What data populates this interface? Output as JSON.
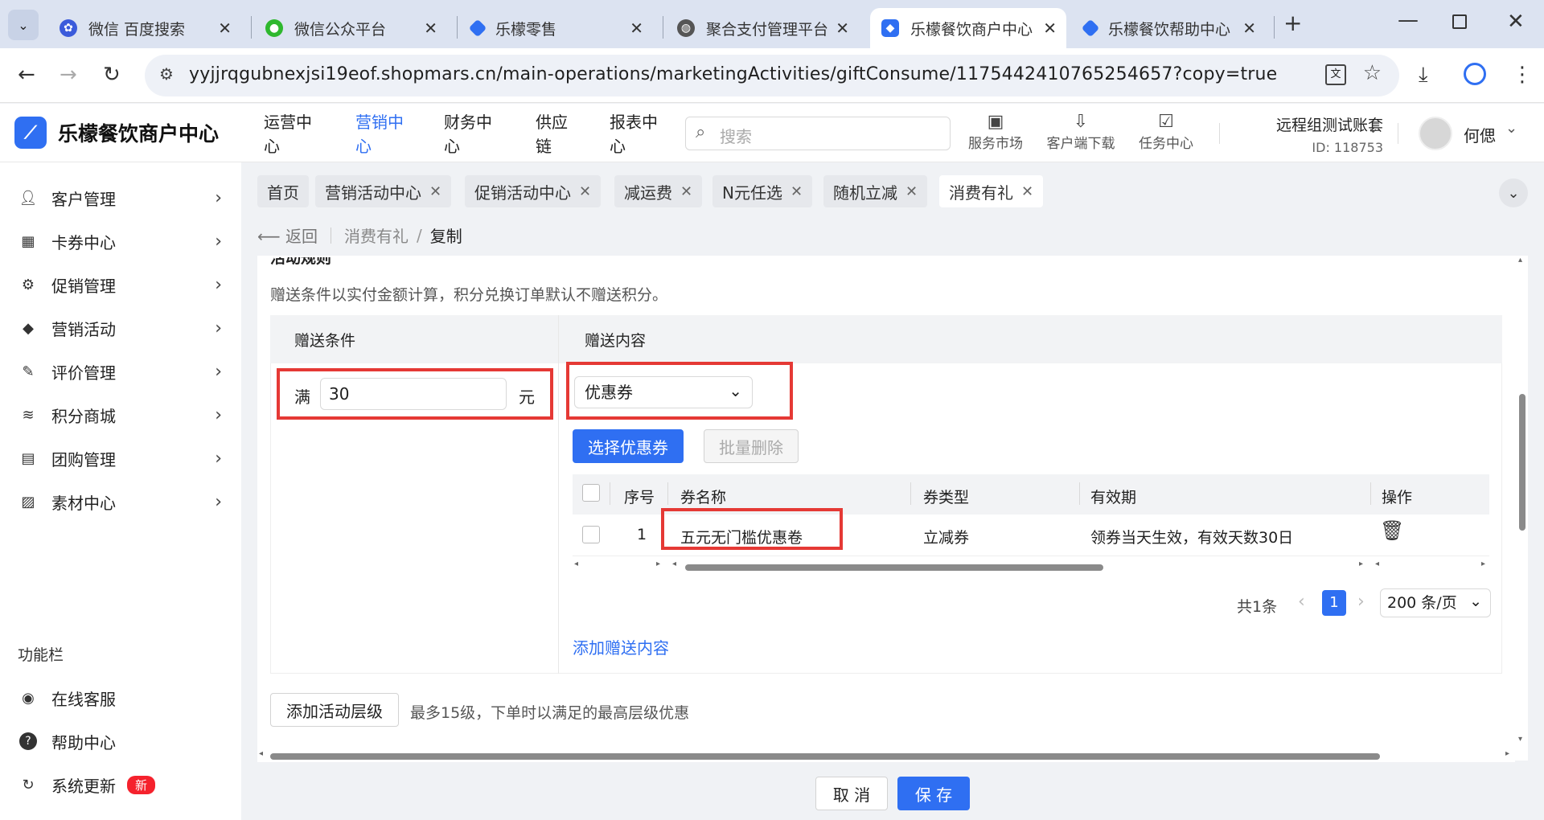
{
  "browser": {
    "tabs": [
      {
        "title": "微信 百度搜索",
        "icon": "baidu-icon",
        "color": "#3b5bdb"
      },
      {
        "title": "微信公众平台",
        "icon": "wechat-icon",
        "color": "#2eb82e"
      },
      {
        "title": "乐檬零售",
        "icon": "lemeng-icon",
        "color": "#2f6ff2"
      },
      {
        "title": "聚合支付管理平台",
        "icon": "globe-icon",
        "color": "#555555"
      },
      {
        "title": "乐檬餐饮商户中心",
        "icon": "lemeng-icon",
        "color": "#2f6ff2"
      },
      {
        "title": "乐檬餐饮帮助中心",
        "icon": "lemeng-icon",
        "color": "#2f6ff2"
      }
    ],
    "url": "yyjjrqgubnexjsi19eof.shopmars.cn/main-operations/marketingActivities/giftConsume/1175442410765254657?copy=true"
  },
  "app": {
    "logo_text": "乐檬餐饮商户中心",
    "nav": [
      "运营中心",
      "营销中心",
      "财务中心",
      "供应链",
      "报表中心"
    ],
    "search_placeholder": "搜索",
    "header_icons": [
      "服务市场",
      "客户端下载",
      "任务中心"
    ],
    "account_name": "远程组测试账套",
    "account_id": "ID: 118753",
    "user_name": "何偲"
  },
  "sidebar": {
    "items": [
      "客户管理",
      "卡券中心",
      "促销管理",
      "营销活动",
      "评价管理",
      "积分商城",
      "团购管理",
      "素材中心"
    ],
    "section_title": "功能栏",
    "func_items": [
      "在线客服",
      "帮助中心",
      "系统更新"
    ],
    "new_badge": "新"
  },
  "page_tabs": [
    "首页",
    "营销活动中心",
    "促销活动中心",
    "减运费",
    "N元任选",
    "随机立减",
    "消费有礼"
  ],
  "breadcrumb": {
    "back": "返回",
    "parent": "消费有礼",
    "sep": "/",
    "current": "复制"
  },
  "rules": {
    "section_title": "活动规则",
    "note": "赠送条件以实付金额计算，积分兑换订单默认不赠送积分。",
    "condition_header": "赠送条件",
    "content_header": "赠送内容",
    "prefix": "满",
    "amount": "30",
    "suffix": "元",
    "gift_type": "优惠券",
    "select_coupon": "选择优惠券",
    "batch_delete": "批量删除",
    "table": {
      "headers": [
        "序号",
        "券名称",
        "券类型",
        "有效期",
        "操作"
      ],
      "rows": [
        {
          "index": "1",
          "name": "五元无门槛优惠卷",
          "type": "立减券",
          "validity": "领券当天生效，有效天数30日"
        }
      ]
    },
    "pagination": {
      "total": "共1条",
      "page": "1",
      "page_size": "200 条/页"
    },
    "add_content": "添加赠送内容",
    "add_level": "添加活动层级",
    "level_note": "最多15级，下单时以满足的最高层级优惠"
  },
  "footer": {
    "cancel": "取 消",
    "save": "保 存"
  },
  "colors": {
    "primary": "#2f6ff2",
    "highlight": "#e53935"
  }
}
